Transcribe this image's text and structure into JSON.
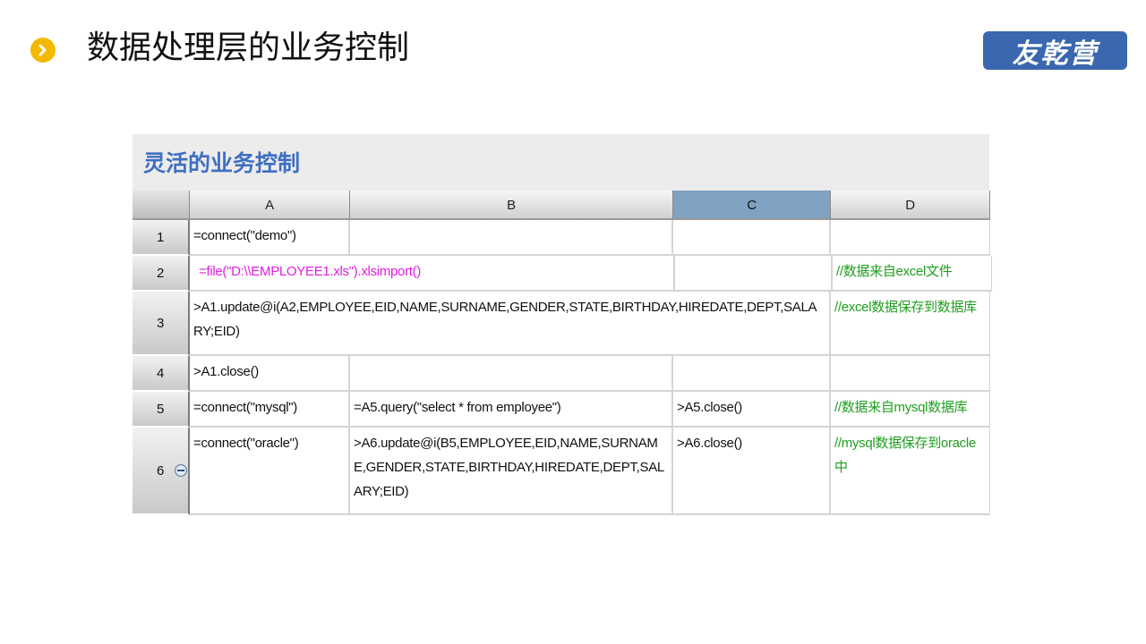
{
  "page": {
    "title": "数据处理层的业务控制",
    "logo_text": "友乾营",
    "bullet_icon": "chevron-right-icon",
    "accent_color": "#f5b800",
    "logo_color": "#3a67ae"
  },
  "panel": {
    "title": "灵活的业务控制",
    "title_color": "#3f6fc3"
  },
  "sheet": {
    "columns": [
      "A",
      "B",
      "C",
      "D"
    ],
    "selected_column": "C",
    "rows": [
      {
        "num": "1",
        "a": "=connect(\"demo\")",
        "b": "",
        "c": "",
        "d": ""
      },
      {
        "num": "2",
        "a": "=file(\"D:\\\\EMPLOYEE1.xls\").xlsimport()",
        "b": "",
        "c": "",
        "d": "//数据来自excel文件"
      },
      {
        "num": "3",
        "a": ">A1.update@i(A2,EMPLOYEE,EID,NAME,SURNAME,GENDER,STATE,BIRTHDAY,HIREDATE,DEPT,SALARY;EID)",
        "b": "",
        "c": "",
        "d": "//excel数据保存到数据库"
      },
      {
        "num": "4",
        "a": ">A1.close()",
        "b": "",
        "c": "",
        "d": ""
      },
      {
        "num": "5",
        "a": "=connect(\"mysql\")",
        "b": "=A5.query(\"select * from employee\")",
        "c": ">A5.close()",
        "d": "//数据来自mysql数据库"
      },
      {
        "num": "6",
        "a": "=connect(\"oracle\")",
        "b": ">A6.update@i(B5,EMPLOYEE,EID,NAME,SURNAME,GENDER,STATE,BIRTHDAY,HIREDATE,DEPT,SALARY;EID)",
        "c": ">A6.close()",
        "d": "//mysql数据保存到oracle中"
      }
    ]
  }
}
